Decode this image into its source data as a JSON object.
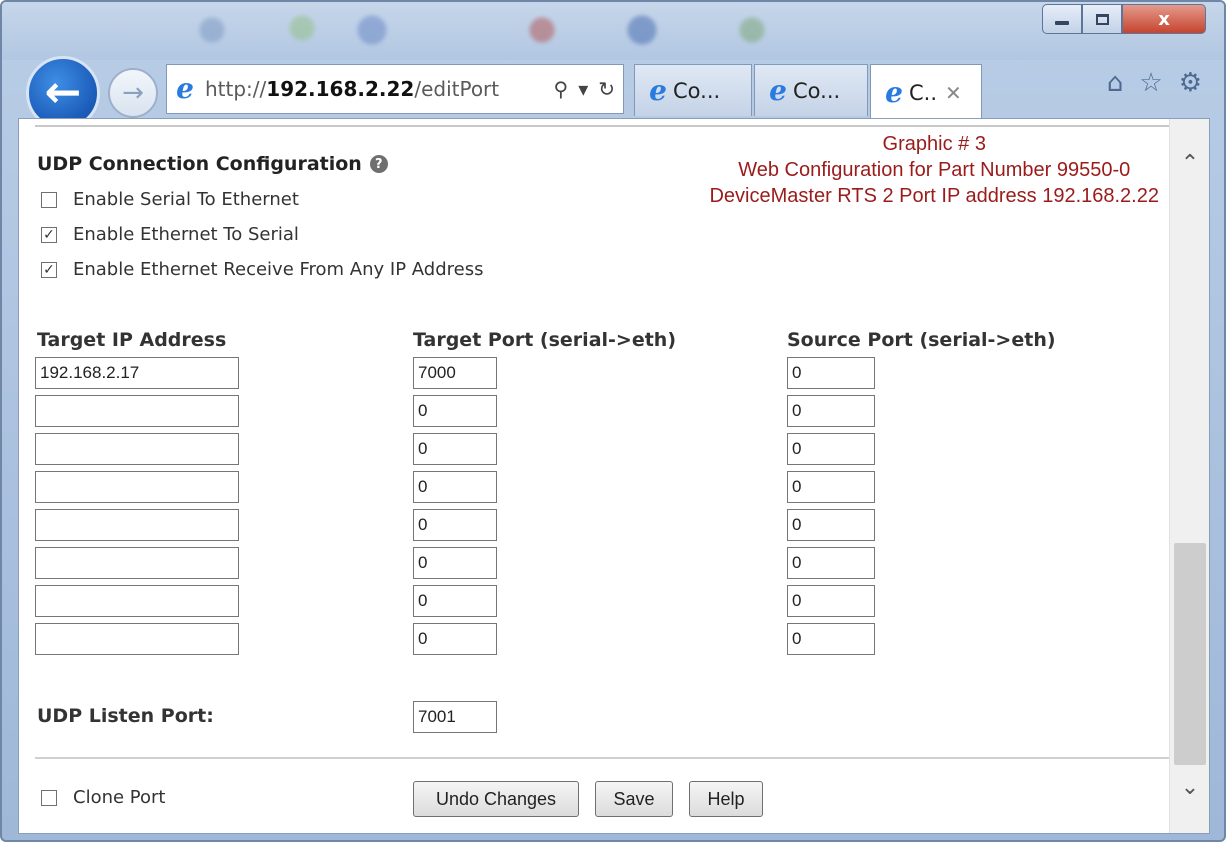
{
  "browser": {
    "address_prefix": "http://",
    "address_host": "192.168.2.22",
    "address_path": "/editPort",
    "tabs": [
      {
        "label": "Co..."
      },
      {
        "label": "Co..."
      },
      {
        "label": "C.."
      }
    ],
    "window_controls": {
      "close": "x"
    }
  },
  "page": {
    "section_title": "UDP Connection Configuration",
    "note": {
      "line1": "Graphic # 3",
      "line2": "Web Configuration for Part Number 99550-0",
      "line3": "DeviceMaster RTS 2 Port IP address 192.168.2.22"
    },
    "options": [
      {
        "label": "Enable Serial To Ethernet",
        "checked": false
      },
      {
        "label": "Enable Ethernet To Serial",
        "checked": true
      },
      {
        "label": "Enable Ethernet Receive From Any IP Address",
        "checked": true
      }
    ],
    "columns": {
      "target_ip": "Target IP Address",
      "target_port": "Target Port (serial->eth)",
      "source_port": "Source Port (serial->eth)"
    },
    "rows": [
      {
        "ip": "192.168.2.17",
        "target_port": "7000",
        "source_port": "0"
      },
      {
        "ip": "",
        "target_port": "0",
        "source_port": "0"
      },
      {
        "ip": "",
        "target_port": "0",
        "source_port": "0"
      },
      {
        "ip": "",
        "target_port": "0",
        "source_port": "0"
      },
      {
        "ip": "",
        "target_port": "0",
        "source_port": "0"
      },
      {
        "ip": "",
        "target_port": "0",
        "source_port": "0"
      },
      {
        "ip": "",
        "target_port": "0",
        "source_port": "0"
      },
      {
        "ip": "",
        "target_port": "0",
        "source_port": "0"
      }
    ],
    "listen_port_label": "UDP Listen Port:",
    "listen_port_value": "7001",
    "clone_label": "Clone Port",
    "clone_checked": false,
    "buttons": {
      "undo": "Undo Changes",
      "save": "Save",
      "help": "Help"
    }
  },
  "colors": {
    "note_text": "#9b1b1b",
    "back_button": "#1a5bb8"
  }
}
